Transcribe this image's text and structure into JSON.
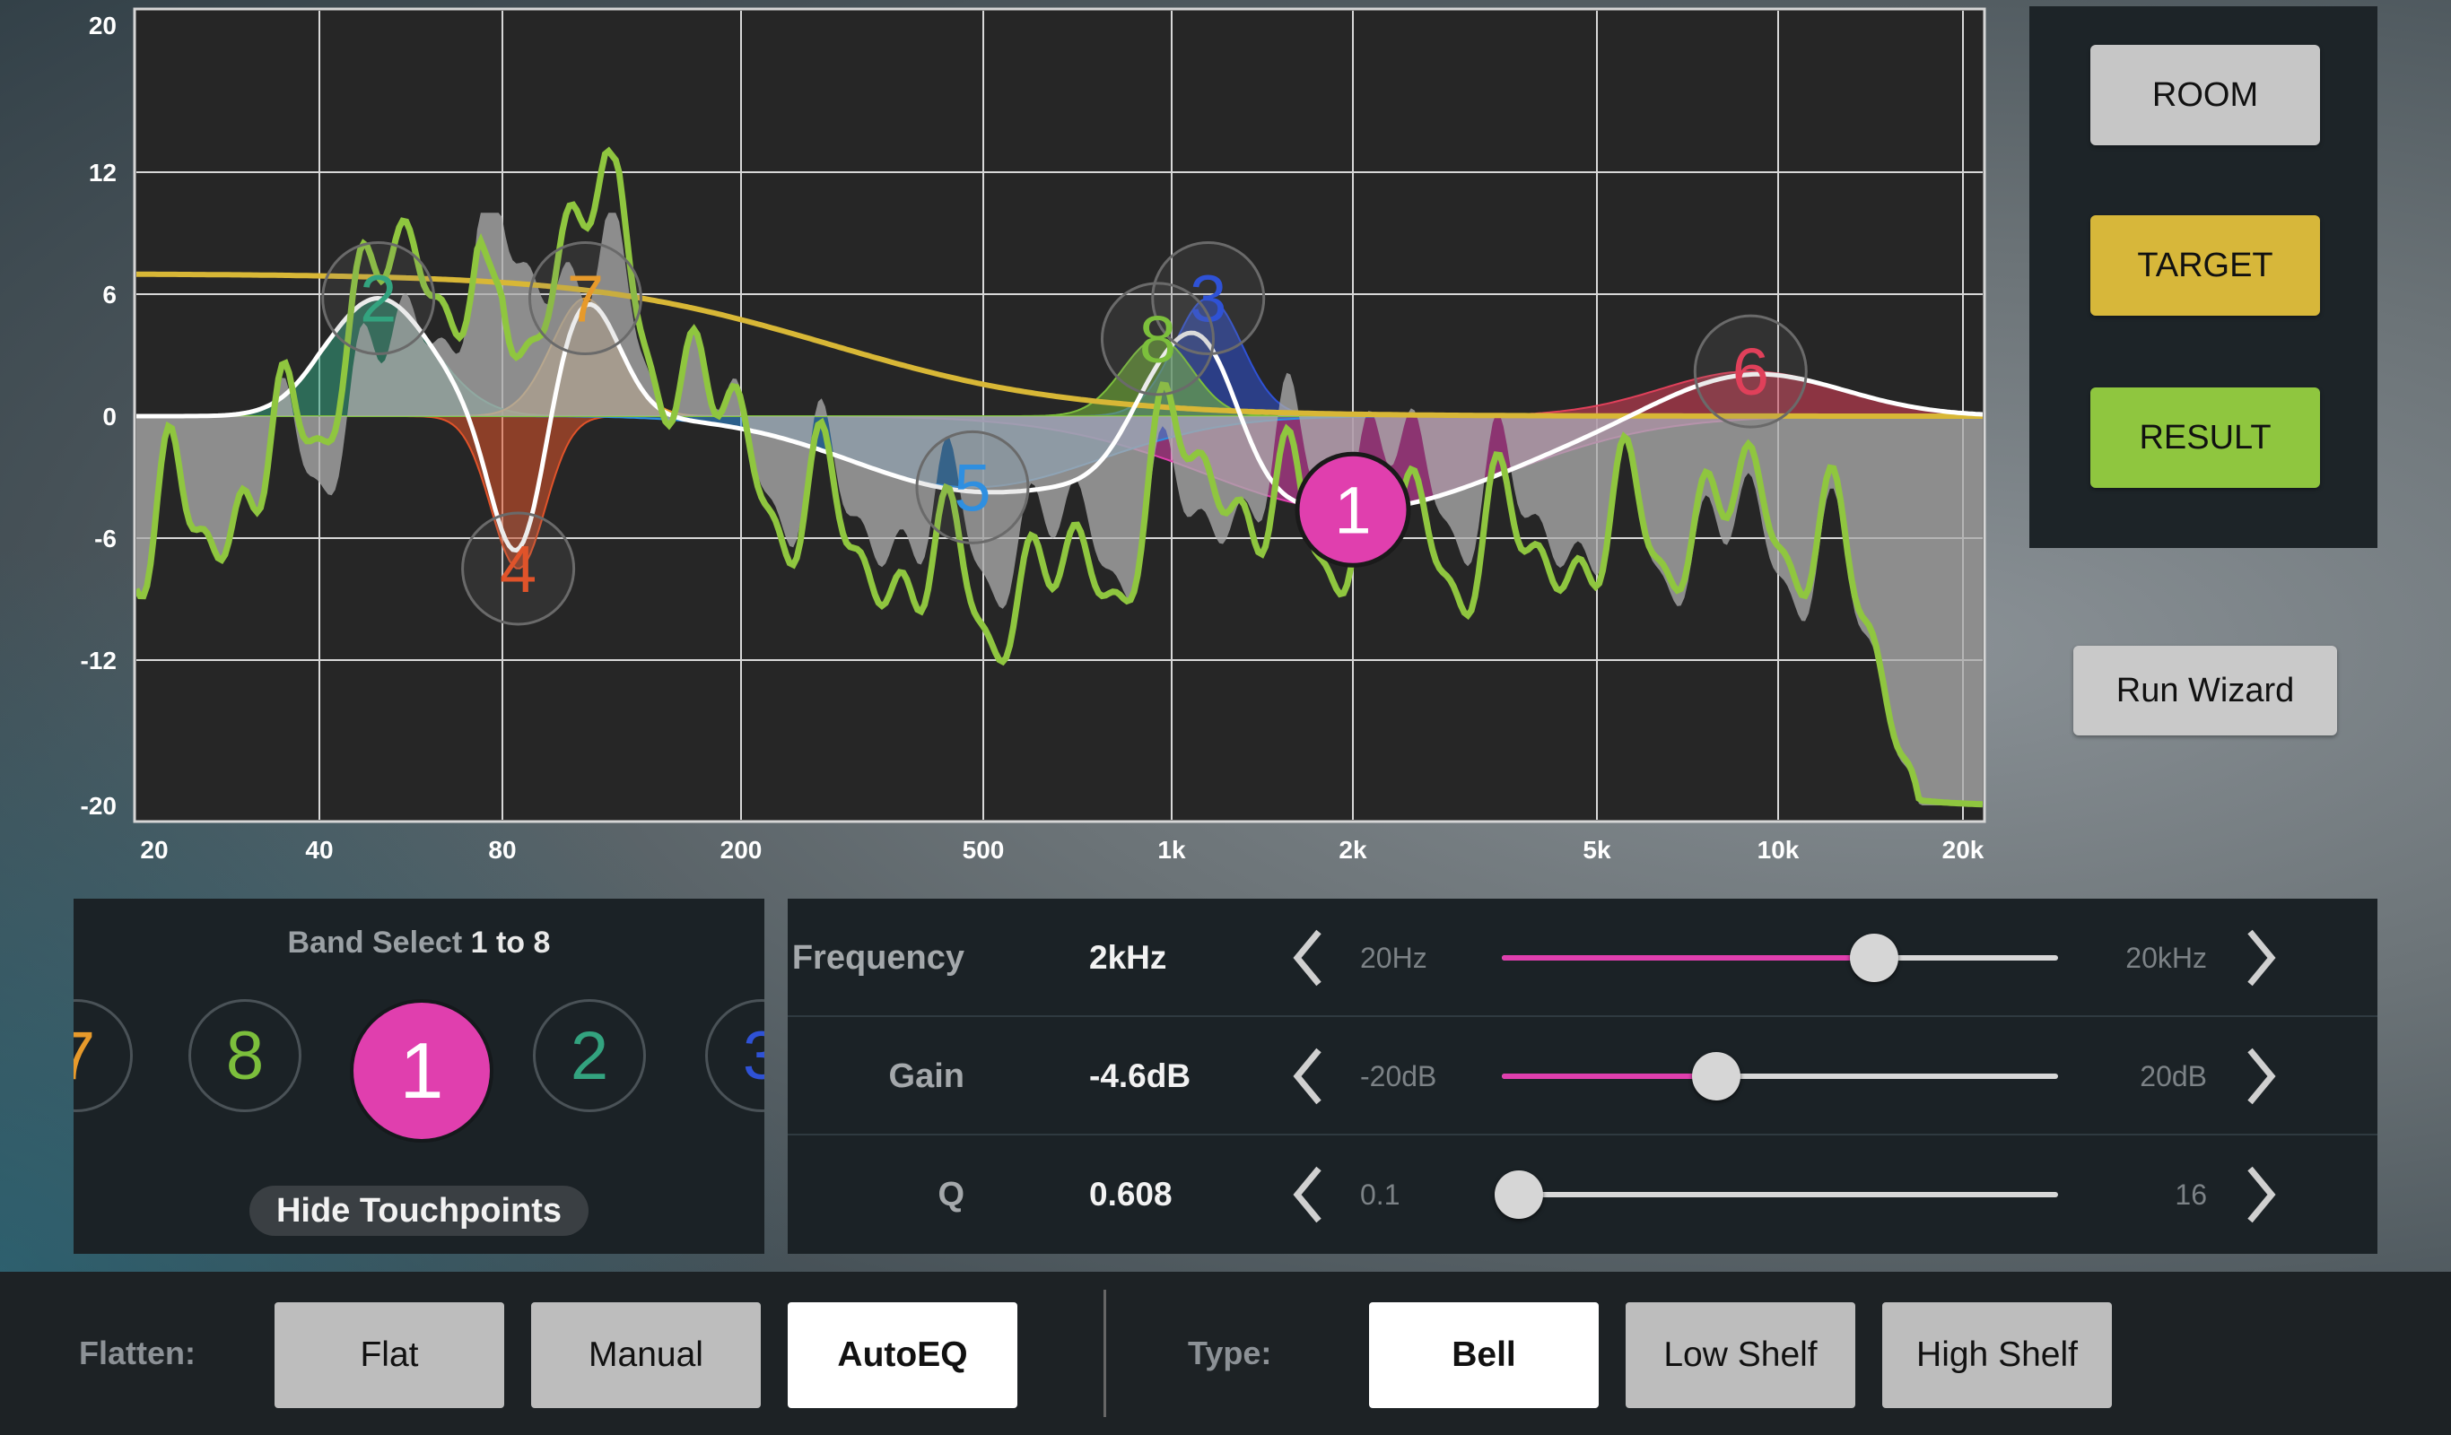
{
  "chart": {
    "y_ticks": [
      "20",
      "12",
      "6",
      "0",
      "-6",
      "-12",
      "-20"
    ],
    "x_ticks": [
      "20",
      "40",
      "80",
      "200",
      "500",
      "1k",
      "2k",
      "5k",
      "10k",
      "20k"
    ],
    "series_colors": {
      "room": "#9a9a9a",
      "target": "#d8b736",
      "result": "#8fc63f",
      "eq_curve": "#ffffff"
    },
    "bands": [
      {
        "id": "1",
        "freq_hz": 2000,
        "gain_db": -4.6,
        "color": "#e03fae",
        "selected": true
      },
      {
        "id": "2",
        "freq_hz": 50,
        "gain_db": 5.8,
        "color": "#33a37f"
      },
      {
        "id": "3",
        "freq_hz": 1150,
        "gain_db": 5.8,
        "color": "#2f52d6"
      },
      {
        "id": "4",
        "freq_hz": 85,
        "gain_db": -7.5,
        "color": "#e0532a"
      },
      {
        "id": "5",
        "freq_hz": 480,
        "gain_db": -3.5,
        "color": "#2f8fe0"
      },
      {
        "id": "6",
        "freq_hz": 9000,
        "gain_db": 2.2,
        "color": "#e0405a"
      },
      {
        "id": "7",
        "freq_hz": 110,
        "gain_db": 5.8,
        "color": "#e79a2b"
      },
      {
        "id": "8",
        "freq_hz": 950,
        "gain_db": 3.8,
        "color": "#7cbf3c"
      }
    ]
  },
  "side": {
    "room_label": "ROOM",
    "target_label": "TARGET",
    "result_label": "RESULT",
    "wizard_label": "Run Wizard"
  },
  "band_select": {
    "title_prefix": "Band Select",
    "title_range": "1 to 8",
    "circles": [
      {
        "label": "7",
        "color": "#e79a2b"
      },
      {
        "label": "8",
        "color": "#7cbf3c"
      },
      {
        "label": "1",
        "color": "#e03fae",
        "selected": true
      },
      {
        "label": "2",
        "color": "#33a37f"
      },
      {
        "label": "3",
        "color": "#2f52d6"
      }
    ],
    "hide_label": "Hide Touchpoints"
  },
  "params": {
    "frequency": {
      "label": "Frequency",
      "value": "2kHz",
      "min": "20Hz",
      "max": "20kHz",
      "level": 0.67
    },
    "gain": {
      "label": "Gain",
      "value": "-4.6dB",
      "min": "-20dB",
      "max": "20dB",
      "level": 0.385
    },
    "q": {
      "label": "Q",
      "value": "0.608",
      "min": "0.1",
      "max": "16",
      "level": 0.03
    }
  },
  "bottom": {
    "flatten_label": "Flatten:",
    "flat": "Flat",
    "manual": "Manual",
    "autoeq": "AutoEQ",
    "type_label": "Type:",
    "bell": "Bell",
    "low_shelf": "Low Shelf",
    "high_shelf": "High Shelf"
  }
}
